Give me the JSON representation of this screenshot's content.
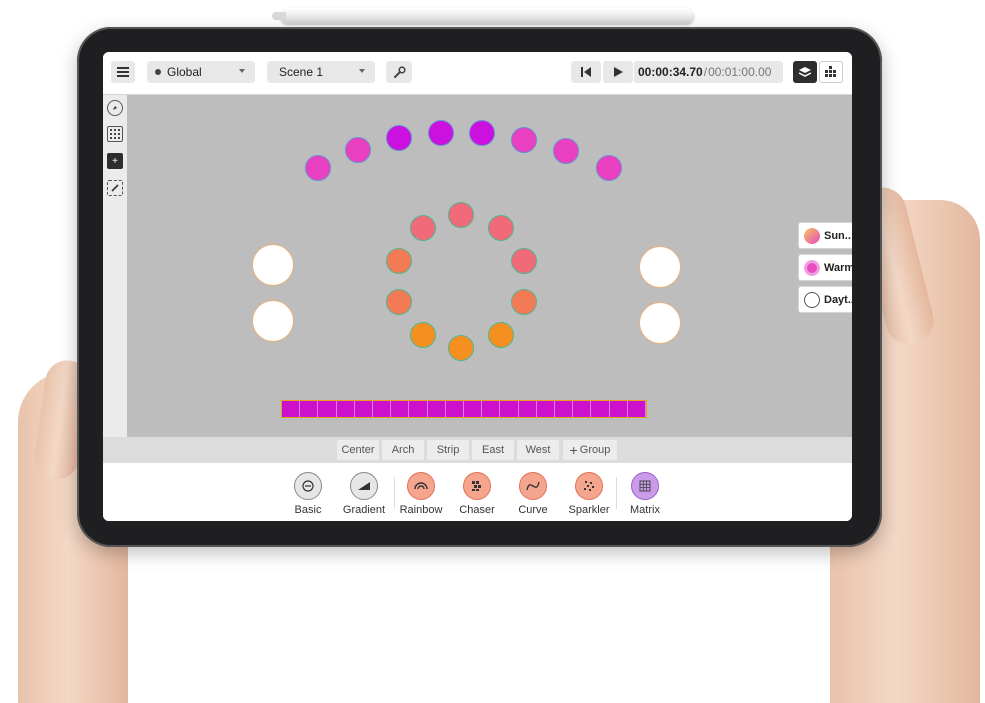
{
  "toolbar": {
    "menu_icon": "hamburger-icon",
    "scope_dropdown": "Global",
    "scene_dropdown": "Scene 1",
    "tool_icon": "wrench-icon",
    "rewind_icon": "skip-back-icon",
    "play_icon": "play-icon",
    "current_time": "00:00:34.70",
    "separator": "/",
    "total_time": "00:01:00.00",
    "layers_icon": "layers-icon",
    "grid_icon": "fixtures-grid-icon"
  },
  "sidebar": {
    "tools": [
      {
        "name": "compass-tool",
        "icon": "compass-icon",
        "active": false
      },
      {
        "name": "grid-tool",
        "icon": "grid-icon",
        "active": false
      },
      {
        "name": "add-tool",
        "icon": "plus-icon",
        "active": true
      },
      {
        "name": "edit-tool",
        "icon": "pencil-icon",
        "active": false
      }
    ]
  },
  "presets": [
    {
      "label": "Sun..",
      "icon": "sunrise-gradient-icon",
      "color": "#f07a4a"
    },
    {
      "label": "Warm",
      "icon": "basic-effect-icon",
      "color": "#e84ec0"
    },
    {
      "label": "Dayt..",
      "icon": "basic-effect-icon",
      "color": "#ffffff"
    }
  ],
  "preset_more": "•••",
  "groups": [
    "Center",
    "Arch",
    "Strip",
    "East",
    "West"
  ],
  "add_group": "Group",
  "effects": [
    {
      "label": "Basic",
      "icon": "basic-icon",
      "color": "#e6e6e6"
    },
    {
      "label": "Gradient",
      "icon": "gradient-icon",
      "color": "#e6e6e6"
    },
    {
      "label": "Rainbow",
      "icon": "rainbow-icon",
      "color": "#f5a58e"
    },
    {
      "label": "Chaser",
      "icon": "chaser-icon",
      "color": "#f5a58e"
    },
    {
      "label": "Curve",
      "icon": "curve-icon",
      "color": "#f5a58e"
    },
    {
      "label": "Sparkler",
      "icon": "sparkler-icon",
      "color": "#f5a58e"
    },
    {
      "label": "Matrix",
      "icon": "matrix-icon",
      "color": "#c99be8"
    }
  ],
  "colors": {
    "arch_outer": "#e840c0",
    "arch_inner": "#cc10e0",
    "ring_pink": "#f06a7a",
    "ring_coral": "#f27a55",
    "ring_orange": "#f59020",
    "strip": "#cc10cc",
    "white_fixture": "#ffffff"
  }
}
